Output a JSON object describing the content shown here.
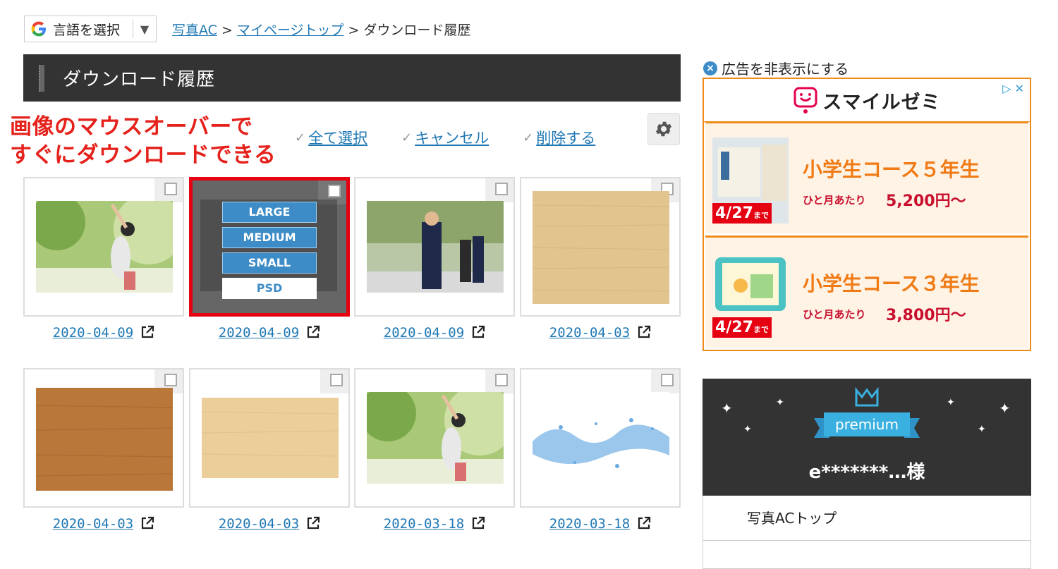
{
  "lang": {
    "label": "言語を選択",
    "arrow": "▼"
  },
  "breadcrumb": {
    "items": [
      "写真AC",
      "マイページトップ"
    ],
    "current": "ダウンロード履歴"
  },
  "header": {
    "title": "ダウンロード履歴"
  },
  "annotation": {
    "line1": "画像のマウスオーバーで",
    "line2": "すぐにダウンロードできる"
  },
  "actions": {
    "select_all": "全て選択",
    "cancel": "キャンセル",
    "delete": "削除する"
  },
  "size_menu": [
    "LARGE",
    "MEDIUM",
    "SMALL",
    "PSD"
  ],
  "cards": [
    {
      "date": "2020-04-09"
    },
    {
      "date": "2020-04-09"
    },
    {
      "date": "2020-04-09"
    },
    {
      "date": "2020-04-03"
    },
    {
      "date": "2020-04-03"
    },
    {
      "date": "2020-04-03"
    },
    {
      "date": "2020-03-18"
    },
    {
      "date": "2020-03-18"
    }
  ],
  "sidebar": {
    "hide_ad": "広告を非表示にする",
    "ad": {
      "brand": "スマイルゼミ",
      "rows": [
        {
          "course": "小学生コース５年生",
          "per_month": "ひと月あたり",
          "price": "5,200円〜",
          "tag": "4/27",
          "tag_suffix": "まで"
        },
        {
          "course": "小学生コース３年生",
          "per_month": "ひと月あたり",
          "price": "3,800円〜",
          "tag": "4/27",
          "tag_suffix": "まで"
        }
      ]
    },
    "premium": {
      "badge": "premium",
      "user": "e*******…様"
    },
    "menu": [
      "写真ACトップ"
    ]
  },
  "colors": {
    "link": "#1f78b4",
    "header_bg": "#333333",
    "annotation": "#e5211b",
    "ad_border": "#f08a1a",
    "accent_blue": "#3d8cc7"
  }
}
